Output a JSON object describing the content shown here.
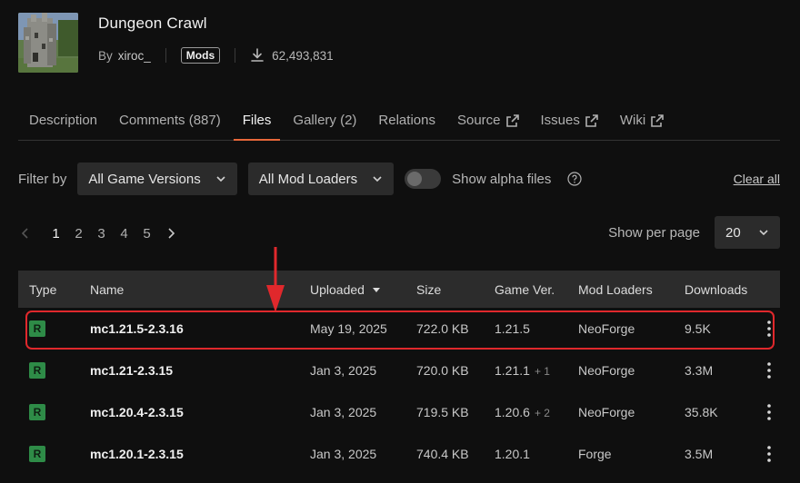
{
  "project": {
    "title": "Dungeon Crawl",
    "by_label": "By",
    "author": "xiroc_",
    "class": "Mods",
    "downloads": "62,493,831"
  },
  "tabs": [
    {
      "label": "Description",
      "external": false,
      "active": false
    },
    {
      "label": "Comments (887)",
      "external": false,
      "active": false
    },
    {
      "label": "Files",
      "external": false,
      "active": true
    },
    {
      "label": "Gallery (2)",
      "external": false,
      "active": false
    },
    {
      "label": "Relations",
      "external": false,
      "active": false
    },
    {
      "label": "Source",
      "external": true,
      "active": false
    },
    {
      "label": "Issues",
      "external": true,
      "active": false
    },
    {
      "label": "Wiki",
      "external": true,
      "active": false
    }
  ],
  "filters": {
    "label": "Filter by",
    "game_version": "All Game Versions",
    "mod_loader": "All Mod Loaders",
    "alpha_label": "Show alpha files",
    "clear": "Clear all"
  },
  "pagination": {
    "pages": [
      "1",
      "2",
      "3",
      "4",
      "5"
    ],
    "current": "1",
    "per_page_label": "Show per page",
    "per_page": "20"
  },
  "table": {
    "headers": {
      "type": "Type",
      "name": "Name",
      "uploaded": "Uploaded",
      "size": "Size",
      "game_ver": "Game Ver.",
      "mod_loaders": "Mod Loaders",
      "downloads": "Downloads"
    },
    "rows": [
      {
        "type": "R",
        "name": "mc1.21.5-2.3.16",
        "uploaded": "May 19, 2025",
        "size": "722.0 KB",
        "game_ver": "1.21.5",
        "extra": "",
        "loader": "NeoForge",
        "downloads": "9.5K"
      },
      {
        "type": "R",
        "name": "mc1.21-2.3.15",
        "uploaded": "Jan 3, 2025",
        "size": "720.0 KB",
        "game_ver": "1.21.1",
        "extra": "+ 1",
        "loader": "NeoForge",
        "downloads": "3.3M"
      },
      {
        "type": "R",
        "name": "mc1.20.4-2.3.15",
        "uploaded": "Jan 3, 2025",
        "size": "719.5 KB",
        "game_ver": "1.20.6",
        "extra": "+ 2",
        "loader": "NeoForge",
        "downloads": "35.8K"
      },
      {
        "type": "R",
        "name": "mc1.20.1-2.3.15",
        "uploaded": "Jan 3, 2025",
        "size": "740.4 KB",
        "game_ver": "1.20.1",
        "extra": "",
        "loader": "Forge",
        "downloads": "3.5M"
      }
    ]
  },
  "colors": {
    "accent": "#e8673a",
    "release_badge": "#2e8b47",
    "highlight": "#e0282c"
  }
}
